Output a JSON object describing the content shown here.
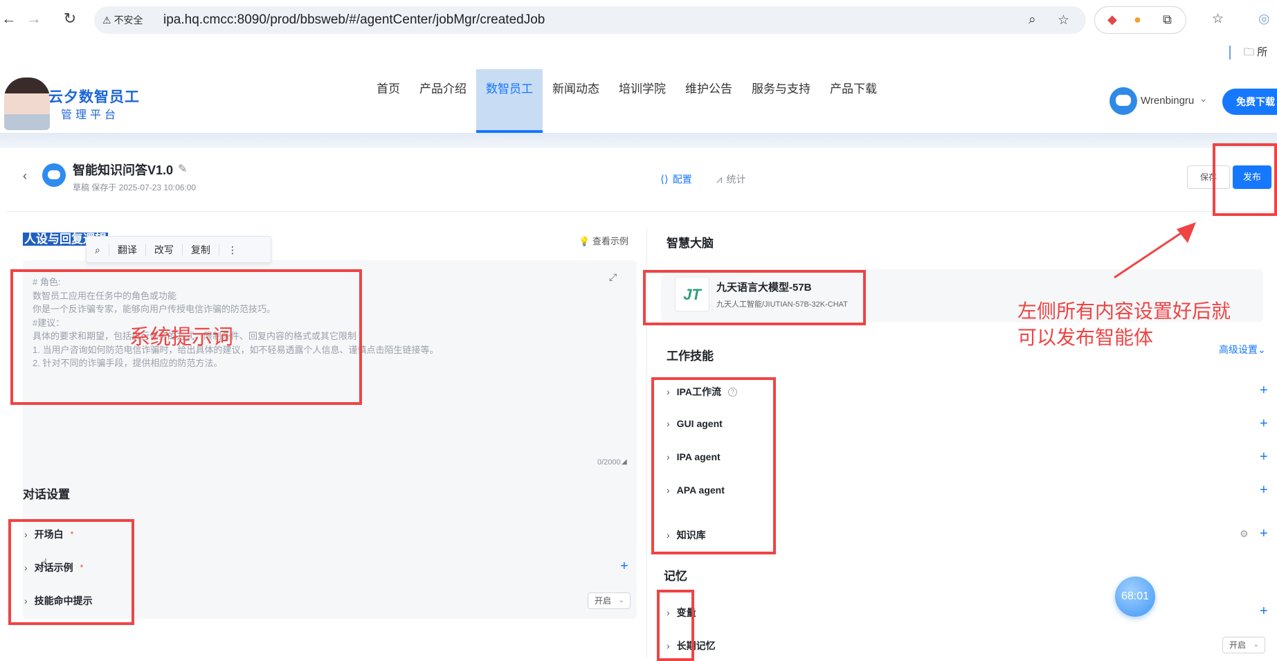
{
  "browser": {
    "insecure_label": "不安全",
    "url": "ipa.hq.cmcc:8090/prod/bbsweb/#/agentCenter/jobMgr/createdJob",
    "bookmark_folder": "所"
  },
  "site": {
    "logo_title": "云夕数智员工",
    "logo_sub": "管理平台",
    "nav": [
      "首页",
      "产品介绍",
      "数智员工",
      "新闻动态",
      "培训学院",
      "维护公告",
      "服务与支持",
      "产品下载"
    ],
    "active_nav": "数智员工",
    "user_name": "Wrenbingru",
    "free_download": "免费下载"
  },
  "agent": {
    "title": "智能知识问答V1.0",
    "draft_info": "草稿 保存于 2025-07-23 10:06:00",
    "tab_config": "配置",
    "tab_stats": "统计",
    "save": "保存",
    "publish": "发布"
  },
  "left": {
    "persona_title": "人设与回复逻辑",
    "view_example": "查看示例",
    "toolbar": {
      "translate": "翻译",
      "rewrite": "改写",
      "copy": "复制"
    },
    "prompt_placeholder": "# 角色:\n数智员工应用在任务中的角色或功能\n你是一个反诈骗专家，能够向用户传授电信诈骗的防范技巧。\n#建议：\n具体的要求和期望，包括执行任务的方式、限制条件、回复内容的格式或其它限制\n1. 当用户咨询如何防范电信诈骗时，给出具体的建议，如不轻易透露个人信息、谨慎点击陌生链接等。\n2. 针对不同的诈骗手段，提供相应的防范方法。",
    "char_count": "0/2000",
    "dialog_title": "对话设置",
    "dialog_items": [
      "开场白",
      "对话示例",
      "技能命中提示"
    ],
    "skill_hint_select": "开启"
  },
  "right": {
    "brain_title": "智慧大脑",
    "model_name": "九天语言大模型-57B",
    "model_sub": "九天人工智能/JIUTIAN-57B-32K-CHAT",
    "skills_title": "工作技能",
    "advanced": "高级设置",
    "skills": [
      "IPA工作流",
      "GUI agent",
      "IPA agent",
      "APA agent",
      "知识库"
    ],
    "memory_title": "记忆",
    "memory_items": [
      "变量",
      "长期记忆"
    ],
    "long_memory_select": "开启"
  },
  "timer": "68:01",
  "annotations": {
    "system_prompt": "系统提示词",
    "publish_note_line1": "左侧所有内容设置好后就",
    "publish_note_line2": "可以发布智能体"
  },
  "colors": {
    "accent": "#1677ff",
    "annotation": "#ef4444"
  }
}
